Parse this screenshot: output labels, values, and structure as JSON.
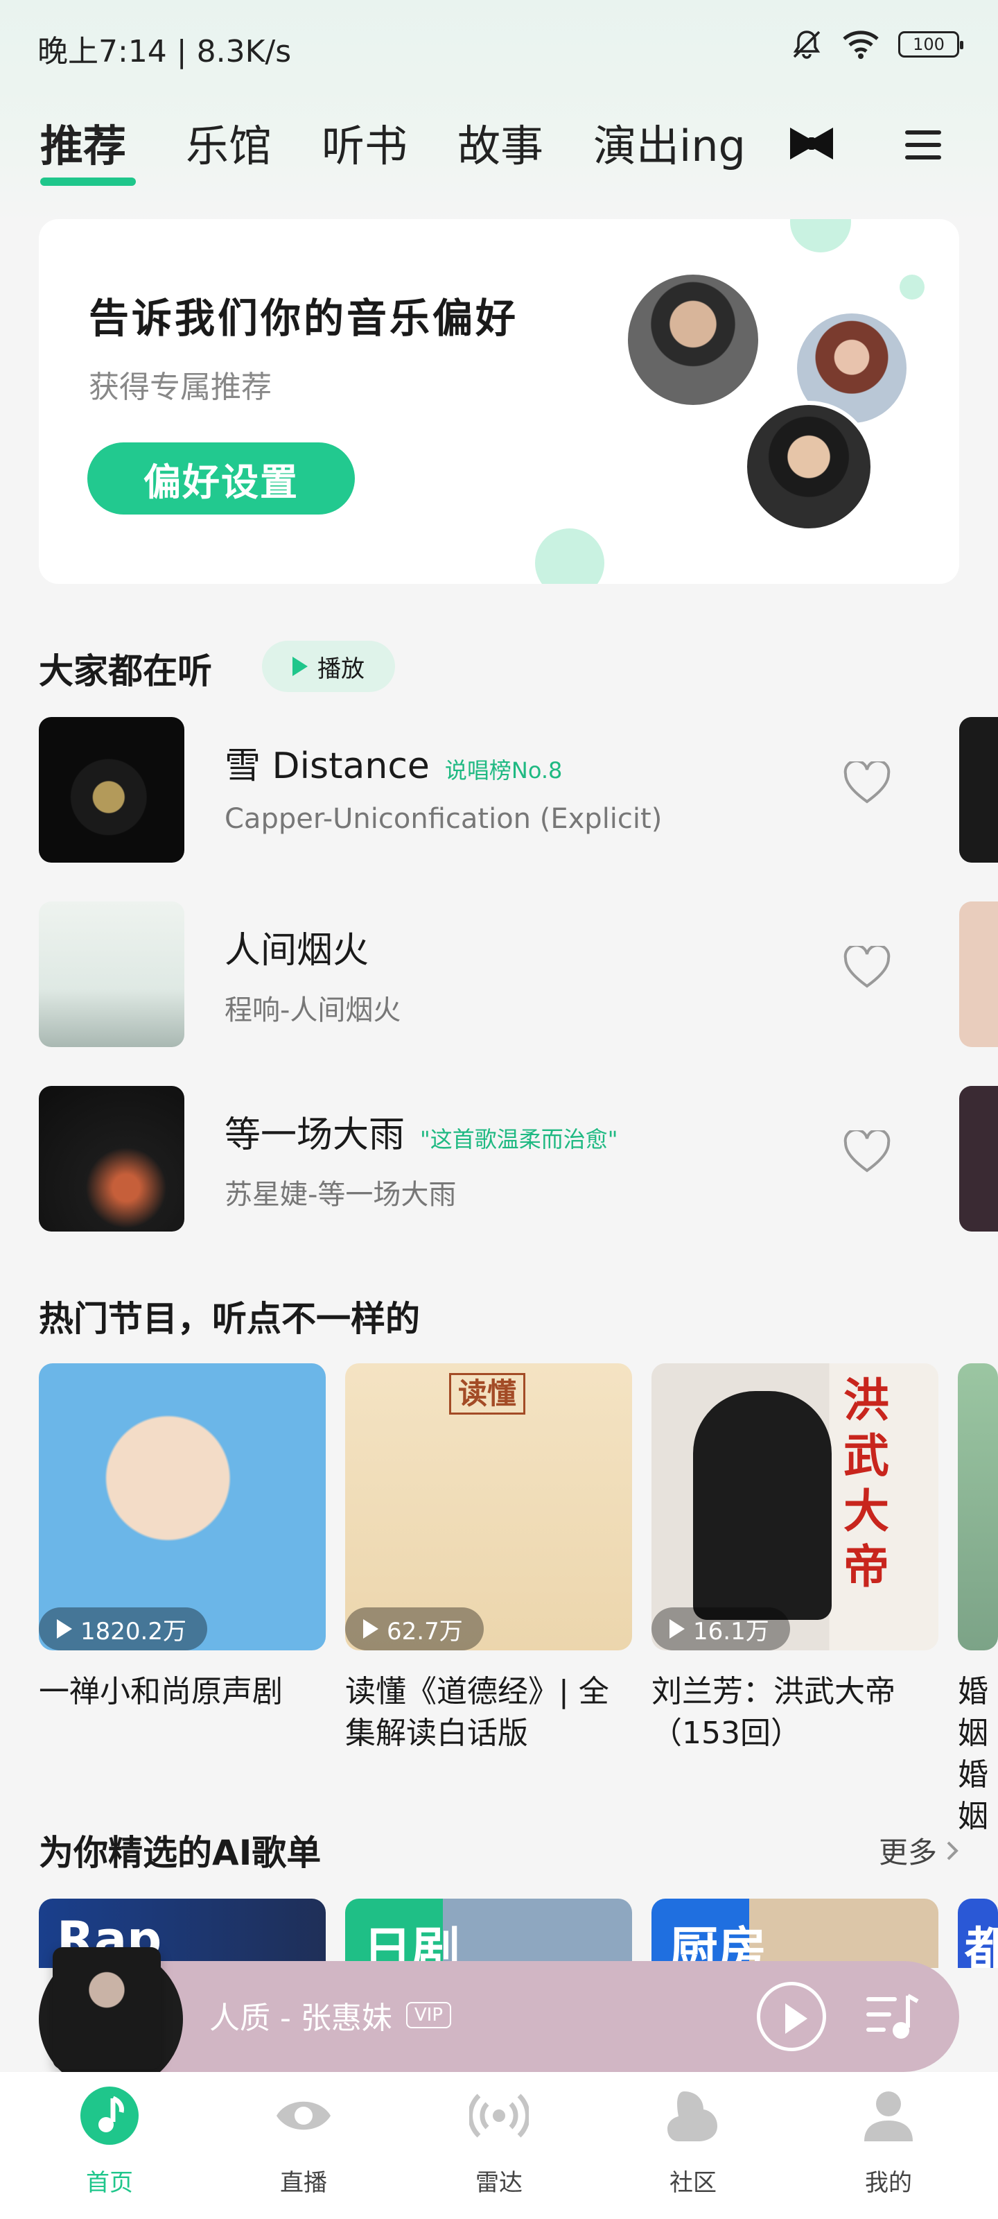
{
  "status": {
    "time": "晚上7:14 | 8.3K/s",
    "battery": "100"
  },
  "tabs": [
    {
      "label": "推荐",
      "active": true
    },
    {
      "label": "乐馆"
    },
    {
      "label": "听书"
    },
    {
      "label": "故事"
    },
    {
      "label": "演出ing"
    }
  ],
  "preference": {
    "title": "告诉我们你的音乐偏好",
    "subtitle": "获得专属推荐",
    "button": "偏好设置"
  },
  "listening": {
    "title": "大家都在听",
    "play_label": "播放",
    "songs": [
      {
        "title": "雪 Distance",
        "tag": "说唱榜No.8",
        "subtitle": "Capper-Uniconfication (Explicit)"
      },
      {
        "title": "人间烟火",
        "tag": "",
        "subtitle": "程响-人间烟火"
      },
      {
        "title": "等一场大雨",
        "tag": "\"这首歌温柔而治愈\"",
        "subtitle": "苏星婕-等一场大雨"
      }
    ]
  },
  "programs": {
    "title": "热门节目，听点不一样的",
    "items": [
      {
        "count": "1820.2万",
        "title": "一禅小和尚原声剧"
      },
      {
        "count": "62.7万",
        "title": "读懂《道德经》| 全集解读白话版",
        "cover_text": "读懂"
      },
      {
        "count": "16.1万",
        "title": "刘兰芳：洪武大帝（153回）",
        "cover_text": "洪武大帝"
      },
      {
        "count": "",
        "title": "婚姻婚姻"
      }
    ]
  },
  "ai_playlists": {
    "title": "为你精选的AI歌单",
    "more": "更多",
    "items": [
      {
        "label": "Rap"
      },
      {
        "label": "日剧"
      },
      {
        "label": "厨房"
      },
      {
        "label": "都"
      }
    ]
  },
  "player": {
    "title": "人质 - 张惠妹",
    "badge": "VIP"
  },
  "bottom_nav": [
    {
      "label": "首页",
      "icon": "music-note-icon",
      "active": true
    },
    {
      "label": "直播",
      "icon": "eye-icon"
    },
    {
      "label": "雷达",
      "icon": "radar-icon"
    },
    {
      "label": "社区",
      "icon": "community-icon"
    },
    {
      "label": "我的",
      "icon": "profile-icon"
    }
  ],
  "colors": {
    "accent": "#1fc68b",
    "player_bg": "#d1b6c4"
  }
}
